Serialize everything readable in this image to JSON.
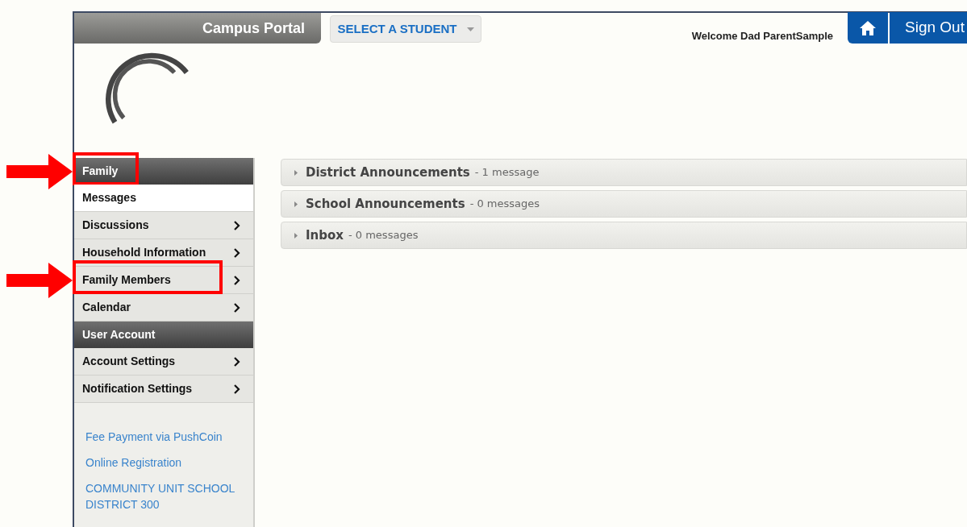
{
  "header": {
    "portal_title": "Campus Portal",
    "student_select": "SELECT A STUDENT",
    "welcome": "Welcome Dad ParentSample",
    "sign_out": "Sign Out"
  },
  "sidebar": {
    "sections": [
      {
        "title": "Family",
        "highlighted": true,
        "items": [
          {
            "label": "Messages",
            "selected": true,
            "has_submenu": false,
            "highlighted": false
          },
          {
            "label": "Discussions",
            "selected": false,
            "has_submenu": true,
            "highlighted": false
          },
          {
            "label": "Household Information",
            "selected": false,
            "has_submenu": true,
            "highlighted": false
          },
          {
            "label": "Family Members",
            "selected": false,
            "has_submenu": true,
            "highlighted": true
          },
          {
            "label": "Calendar",
            "selected": false,
            "has_submenu": true,
            "highlighted": false
          }
        ]
      },
      {
        "title": "User Account",
        "highlighted": false,
        "items": [
          {
            "label": "Account Settings",
            "selected": false,
            "has_submenu": true,
            "highlighted": false
          },
          {
            "label": "Notification Settings",
            "selected": false,
            "has_submenu": true,
            "highlighted": false
          }
        ]
      }
    ],
    "links": [
      "Fee Payment via PushCoin",
      "Online Registration",
      "COMMUNITY UNIT SCHOOL DISTRICT 300"
    ]
  },
  "panels": [
    {
      "title": "District Announcements",
      "count": "- 1 message"
    },
    {
      "title": "School Announcements",
      "count": "- 0 messages"
    },
    {
      "title": "Inbox",
      "count": "- 0 messages"
    }
  ]
}
